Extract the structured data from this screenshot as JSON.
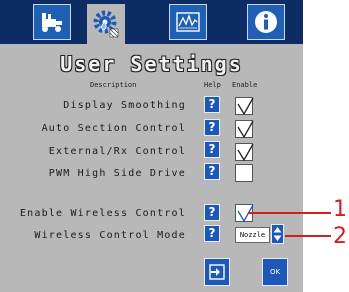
{
  "tabs": [
    {
      "icon": "machine-icon",
      "active": false
    },
    {
      "icon": "settings-gear-icon",
      "active": true
    },
    {
      "icon": "graph-icon",
      "active": false
    },
    {
      "icon": "info-icon",
      "active": false
    }
  ],
  "title": "User Settings",
  "columns": {
    "description": "Description",
    "help": "Help",
    "enable": "Enable"
  },
  "settings": [
    {
      "label": "Display Smoothing",
      "help": "?",
      "checked": true
    },
    {
      "label": "Auto Section Control",
      "help": "?",
      "checked": true
    },
    {
      "label": "External/Rx Control",
      "help": "?",
      "checked": true
    },
    {
      "label": "PWM High Side Drive",
      "help": "?",
      "checked": false
    },
    {
      "label": "Enable Wireless Control",
      "help": "?",
      "checked": true
    }
  ],
  "wireless_mode": {
    "label": "Wireless Control Mode",
    "help": "?",
    "value": "Nozzle"
  },
  "buttons": {
    "ok": "OK",
    "exit_icon": "exit-icon"
  },
  "callouts": [
    "1",
    "2"
  ],
  "colors": {
    "accent": "#1d57b8",
    "header": "#0d2c66",
    "panel": "#b8b8b8",
    "callout": "#d11f1f"
  }
}
